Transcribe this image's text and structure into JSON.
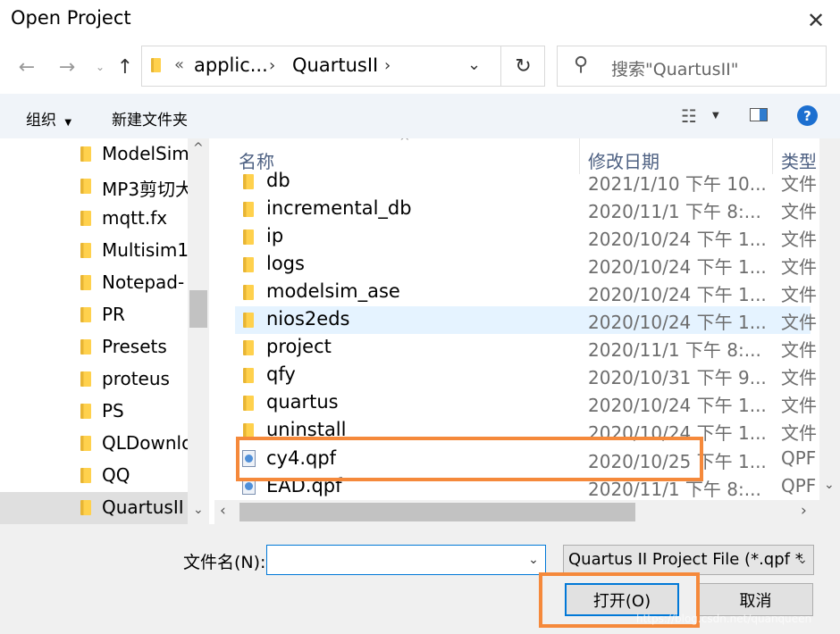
{
  "window": {
    "title": "Open Project"
  },
  "nav": {
    "address_prefix": "«",
    "breadcrumb": [
      "applic...",
      "QuartusII"
    ],
    "search_placeholder": "搜索\"QuartusII\""
  },
  "toolbar": {
    "organize": "组织",
    "new_folder": "新建文件夹"
  },
  "sidebar": {
    "items": [
      "ModelSim",
      "MP3剪切大",
      "mqtt.fx",
      "Multisim1",
      "Notepad-",
      "PR",
      "Presets",
      "proteus",
      "PS",
      "QLDownlo",
      "QQ",
      "QuartusII"
    ]
  },
  "columns": {
    "name": "名称",
    "date": "修改日期",
    "type": "类型"
  },
  "files": [
    {
      "name": "db",
      "date": "2021/1/10 下午 10...",
      "type": "文件",
      "kind": "folder"
    },
    {
      "name": "incremental_db",
      "date": "2020/11/1 下午 8:...",
      "type": "文件",
      "kind": "folder"
    },
    {
      "name": "ip",
      "date": "2020/10/24 下午 1...",
      "type": "文件",
      "kind": "folder"
    },
    {
      "name": "logs",
      "date": "2020/10/24 下午 1...",
      "type": "文件",
      "kind": "folder"
    },
    {
      "name": "modelsim_ase",
      "date": "2020/10/24 下午 1...",
      "type": "文件",
      "kind": "folder"
    },
    {
      "name": "nios2eds",
      "date": "2020/10/24 下午 1...",
      "type": "文件",
      "kind": "folder"
    },
    {
      "name": "project",
      "date": "2020/11/1 下午 8:...",
      "type": "文件",
      "kind": "folder"
    },
    {
      "name": "qfy",
      "date": "2020/10/31 下午 9...",
      "type": "文件",
      "kind": "folder"
    },
    {
      "name": "quartus",
      "date": "2020/10/24 下午 1...",
      "type": "文件",
      "kind": "folder"
    },
    {
      "name": "uninstall",
      "date": "2020/10/24 下午 1...",
      "type": "文件",
      "kind": "folder"
    },
    {
      "name": "cy4.qpf",
      "date": "2020/10/25 下午 1...",
      "type": "QPF",
      "kind": "file"
    },
    {
      "name": "EAD.qpf",
      "date": "2020/11/1 下午 8:...",
      "type": "QPF",
      "kind": "file"
    }
  ],
  "bottom": {
    "filename_label": "文件名(N):",
    "filename_value": "",
    "filter": "Quartus II Project File (*.qpf *",
    "open_button": "打开(O)",
    "cancel_button": "取消"
  },
  "watermark": "https://blog.csdn.net/quanqueen",
  "colors": {
    "accent": "#0078d7",
    "highlight": "#f5893b",
    "hover_row": "#e5f3ff",
    "toolbar_bg": "#f0f4f9"
  }
}
